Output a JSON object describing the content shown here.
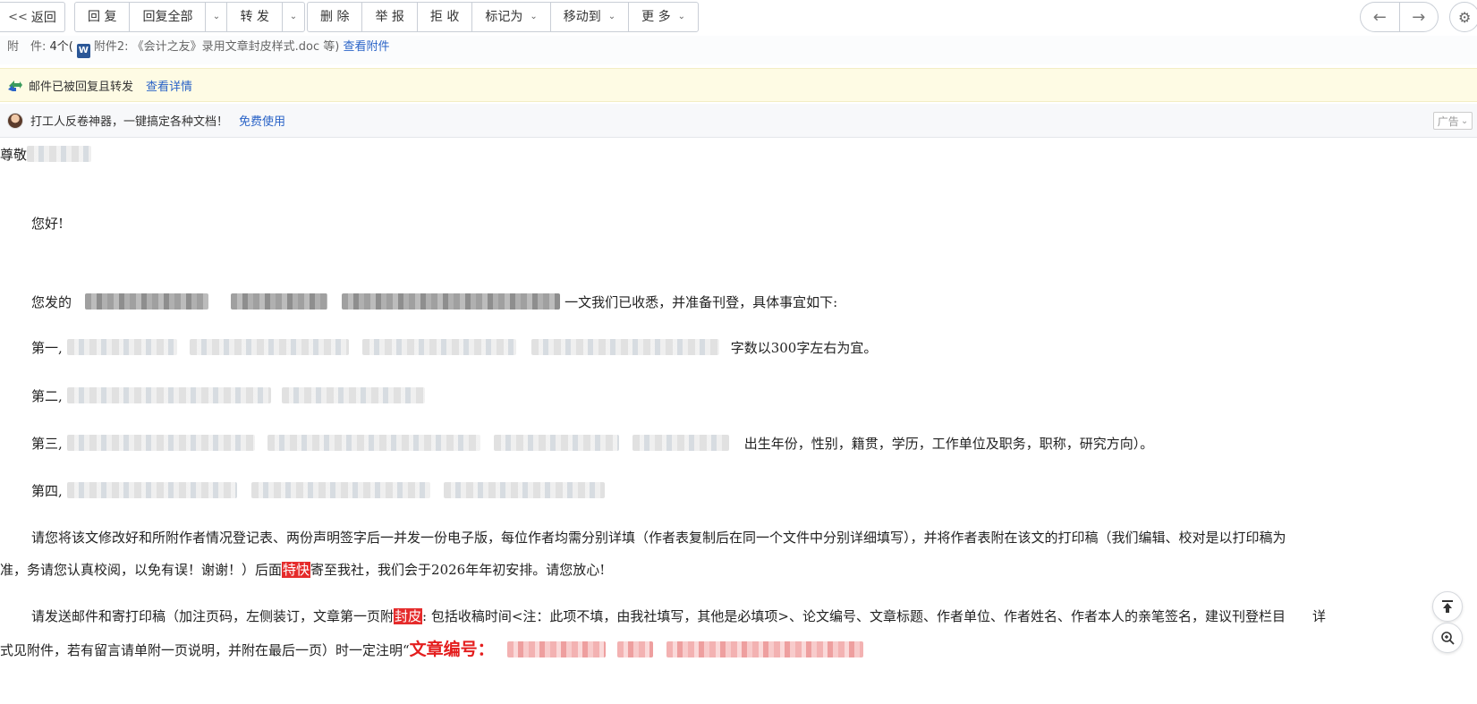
{
  "toolbar": {
    "back": "返回",
    "group1": [
      "回 复",
      "回复全部",
      "转 发"
    ],
    "group2": [
      "删 除",
      "举 报",
      "拒 收",
      "标记为",
      "移动到",
      "更 多"
    ]
  },
  "attachment": {
    "label": "附　件:",
    "count": "4个(",
    "file_text": "附件2: 《会计之友》录用文章封皮样式.doc 等)",
    "view_link": "查看附件"
  },
  "notice": {
    "text": "邮件已被回复且转发",
    "link": "查看详情"
  },
  "ad": {
    "text": "打工人反卷神器，一键搞定各种文档！",
    "link": "免费使用",
    "tag": "广告"
  },
  "body": {
    "greeting": "尊敬",
    "hello": "您好!",
    "p1_prefix": "您发的",
    "p1_suffix": "一文我们已收悉，并准备刊登，具体事宜如下:",
    "item1_label": "第一,",
    "item1_suffix": "字数以300字左右为宜。",
    "item2_label": "第二,",
    "item3_label": "第三,",
    "item3_suffix": "出生年份，性别，籍贯，学历，工作单位及职务，职称，研究方向）。",
    "item4_label": "第四,",
    "p5_line1": "请您将该文修改好和所附作者情况登记表、两份声明签字后一并发一份电子版，每位作者均需分别详填（作者表复制后在同一个文件中分别详细填写），并将作者表附在该文的打印稿（我们编辑、校对是以打印稿为",
    "p5_line2_a": "准，务请您认真校阅，以免有误！谢谢！）后面",
    "p5_hl": "特快",
    "p5_line2_b": "寄至我社，我们会于2026年年初安排。请您放心!",
    "p6_line1_a": "请发送邮件和寄打印稿（加注页码，左侧装订，文章第一页附",
    "p6_hl": "封皮",
    "p6_line1_b": ": 包括收稿时间<注：此项不填，由我社填写，其他是必填项>、论文编号、文章标题、作者单位、作者姓名、作者本人的亲笔签名，建议刊登栏目",
    "p6_line1_c": "详",
    "p6_line2_a": "式见附件，若有留言请单附一页说明，并附在最后一页）时一定注明“",
    "p6_red": "文章编号："
  },
  "icons": {
    "back": "double-chevron-left-icon",
    "prev": "arrow-left-icon",
    "next": "arrow-right-icon",
    "settings": "gear-icon",
    "forward": "forwarded-mail-icon",
    "doc": "word-doc-icon",
    "top": "back-to-top-icon",
    "zoom": "zoom-in-icon"
  },
  "colors": {
    "link": "#2a63c7",
    "notice_bg": "#fefbe4",
    "highlight": "#e52b2b",
    "emphasis_red": "#e41e1e"
  }
}
